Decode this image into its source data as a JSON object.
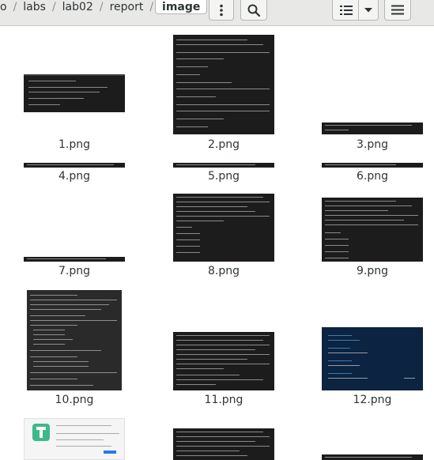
{
  "breadcrumb": {
    "items": [
      "o",
      "labs",
      "lab02",
      "report"
    ],
    "current": "image"
  },
  "header": {
    "menu_icon": "vertical-dots-icon",
    "search_icon": "search-icon",
    "view_icon": "list-view-icon",
    "dropdown_icon": "chevron-down-icon",
    "hamburger_icon": "hamburger-menu-icon"
  },
  "files": [
    {
      "name": "1.png"
    },
    {
      "name": "2.png"
    },
    {
      "name": "3.png"
    },
    {
      "name": "4.png"
    },
    {
      "name": "5.png"
    },
    {
      "name": "6.png"
    },
    {
      "name": "7.png"
    },
    {
      "name": "8.png"
    },
    {
      "name": "9.png"
    },
    {
      "name": "10.png"
    },
    {
      "name": "11.png"
    },
    {
      "name": "12.png"
    }
  ]
}
